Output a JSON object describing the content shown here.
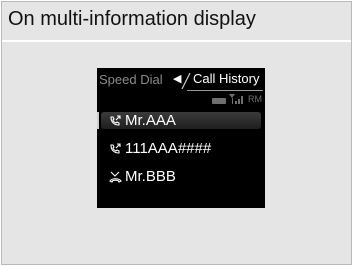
{
  "caption": "On multi-information display",
  "display": {
    "tabs": {
      "inactive": "Speed Dial",
      "arrow": "◀",
      "active": "Call History"
    },
    "status": {
      "roaming": "RM"
    },
    "calls": [
      {
        "name": "Mr.AAA",
        "type": "outgoing-call-icon",
        "selected": true
      },
      {
        "name": "111AAA####",
        "type": "outgoing-call-icon",
        "selected": false
      },
      {
        "name": "Mr.BBB",
        "type": "missed-call-icon",
        "selected": false
      }
    ]
  }
}
